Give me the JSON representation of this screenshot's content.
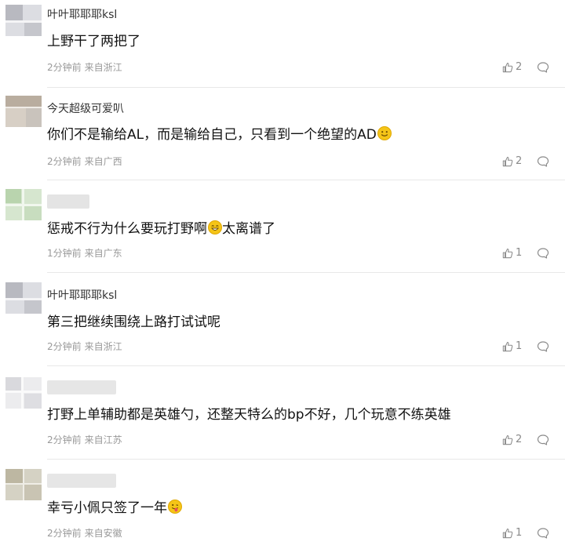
{
  "comments": [
    {
      "username": "叶叶耶耶耶ksl",
      "text": "上野干了两把了",
      "time": "2分钟前",
      "location": "来自浙江",
      "likes": "2"
    },
    {
      "username": "今天超级可爱叭",
      "text": "你们不是输给AL，而是输给自己，只看到一个绝望的AD",
      "emoji": "smile-emoji",
      "time": "2分钟前",
      "location": "来自广西",
      "likes": "2"
    },
    {
      "username": "",
      "text_before": "惩戒不行为什么要玩打野啊",
      "text_after": "太离谱了",
      "emoji": "grin-emoji",
      "time": "1分钟前",
      "location": "来自广东",
      "likes": "1"
    },
    {
      "username": "叶叶耶耶耶ksl",
      "text": "第三把继续围绕上路打试试呢",
      "time": "2分钟前",
      "location": "来自浙江",
      "likes": "1"
    },
    {
      "username": "",
      "text": "打野上单辅助都是英雄勺，还整天特么的bp不好，几个玩意不练英雄",
      "time": "2分钟前",
      "location": "来自江苏",
      "likes": "2"
    },
    {
      "username": "",
      "text": "幸亏小佩只签了一年",
      "emoji": "tongue-emoji",
      "time": "2分钟前",
      "location": "来自安徽",
      "likes": "1"
    }
  ],
  "icons": {
    "like": "thumbs-up-icon",
    "reply": "comment-bubble-icon"
  },
  "colors": {
    "text": "#111111",
    "meta": "#999999",
    "divider": "#e8e8e8",
    "emoji": "#f5c518"
  }
}
